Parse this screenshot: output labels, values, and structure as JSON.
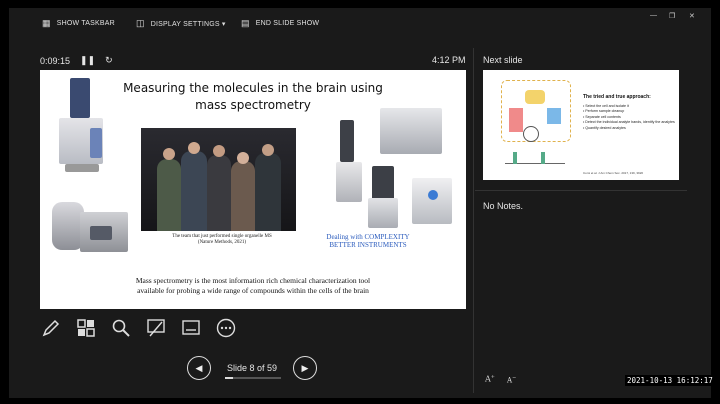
{
  "topbar": {
    "show_taskbar": "SHOW TASKBAR",
    "display_settings": "DISPLAY SETTINGS ▾",
    "end_slide_show": "END SLIDE SHOW"
  },
  "presenter": {
    "elapsed": "0:09:15",
    "clock": "4:12 PM",
    "next_slide_label": "Next slide",
    "notes": "No Notes."
  },
  "current_slide": {
    "title_line1": "Measuring the molecules in the brain using",
    "title_line2": "mass spectrometry",
    "caption_line1": "The team that just performed single organelle MS",
    "caption_line2": "(Nature Methods, 2021)",
    "dealing_line1": "Dealing with COMPLEXITY",
    "dealing_line2": "BETTER INSTRUMENTS",
    "body_line1": "Mass spectrometry is the most information rich chemical characterization tool",
    "body_line2": "available for probing a wide range of compounds within the cells of the brain"
  },
  "next_slide": {
    "title": "The tried and true approach:",
    "items": [
      "Select the cell and isolate it",
      "Perform sample cleanup",
      "Separate cell contents",
      "Detect the individual analyte bands, identify the analytes",
      "Quantify desired analytes"
    ],
    "reference": "Comi et al. J Am Chem Soc. 2017, 139, 3920"
  },
  "navigation": {
    "slide_counter": "Slide 8 of 59",
    "progress_fraction": 0.1356
  },
  "icons": [
    "taskbar-icon",
    "display-icon",
    "end-show-icon",
    "pause-icon",
    "restart-icon",
    "pen-icon",
    "grid-icon",
    "zoom-icon",
    "pointer-icon",
    "subtitles-icon",
    "more-icon",
    "prev-icon",
    "next-icon",
    "font-increase-icon",
    "font-decrease-icon"
  ],
  "timestamp": "2021-10-13  16:12:17",
  "font_controls": {
    "increase": "A",
    "decrease": "A"
  }
}
